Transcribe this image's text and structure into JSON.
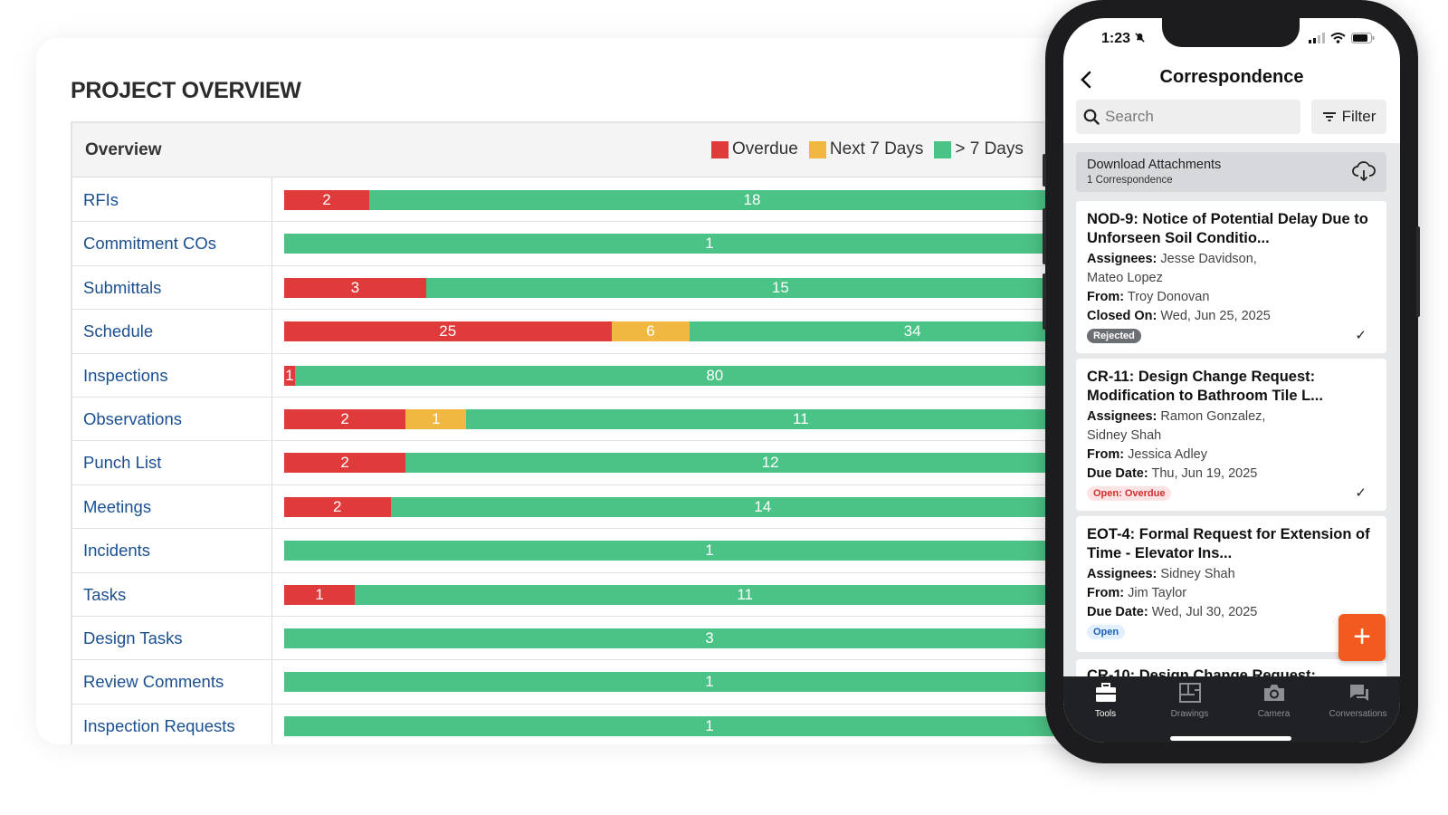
{
  "panel": {
    "title": "PROJECT OVERVIEW",
    "column_header": "Overview",
    "legend": [
      {
        "label": "Overdue",
        "color": "#e03b3b"
      },
      {
        "label": "Next 7 Days",
        "color": "#f0b840"
      },
      {
        "label": "> 7 Days",
        "color": "#4cc386"
      }
    ],
    "rows": [
      {
        "label": "RFIs",
        "overdue": 2,
        "next7": 0,
        "later": 18
      },
      {
        "label": "Commitment COs",
        "overdue": 0,
        "next7": 0,
        "later": 1
      },
      {
        "label": "Submittals",
        "overdue": 3,
        "next7": 0,
        "later": 15
      },
      {
        "label": "Schedule",
        "overdue": 25,
        "next7": 6,
        "later": 34
      },
      {
        "label": "Inspections",
        "overdue": 1,
        "next7": 0,
        "later": 80
      },
      {
        "label": "Observations",
        "overdue": 2,
        "next7": 1,
        "later": 11
      },
      {
        "label": "Punch List",
        "overdue": 2,
        "next7": 0,
        "later": 12
      },
      {
        "label": "Meetings",
        "overdue": 2,
        "next7": 0,
        "later": 14
      },
      {
        "label": "Incidents",
        "overdue": 0,
        "next7": 0,
        "later": 1
      },
      {
        "label": "Tasks",
        "overdue": 1,
        "next7": 0,
        "later": 11
      },
      {
        "label": "Design Tasks",
        "overdue": 0,
        "next7": 0,
        "later": 3
      },
      {
        "label": "Review Comments",
        "overdue": 0,
        "next7": 0,
        "later": 1
      },
      {
        "label": "Inspection Requests",
        "overdue": 0,
        "next7": 0,
        "later": 1
      }
    ]
  },
  "phone": {
    "status_time": "1:23",
    "title": "Correspondence",
    "search_placeholder": "Search",
    "filter_label": "Filter",
    "download": {
      "title": "Download Attachments",
      "subtitle": "1 Correspondence"
    },
    "cards": [
      {
        "title": "NOD-9: Notice of Potential Delay Due to Unforseen Soil Conditio...",
        "assignees_label": "Assignees:",
        "assignees_1": "Jesse Davidson,",
        "assignees_2": "Mateo Lopez",
        "from_label": "From:",
        "from": "Troy Donovan",
        "date_label": "Closed On:",
        "date": "Wed, Jun 25, 2025",
        "status": "Rejected",
        "status_bg": "#6b6e72",
        "status_color": "#ffffff",
        "checked": true
      },
      {
        "title": "CR-11: Design Change Request: Modification to Bathroom Tile L...",
        "assignees_label": "Assignees:",
        "assignees_1": "Ramon Gonzalez,",
        "assignees_2": "Sidney Shah",
        "from_label": "From:",
        "from": "Jessica Adley",
        "date_label": "Due Date:",
        "date": "Thu, Jun 19, 2025",
        "status": "Open: Overdue",
        "status_bg": "#fde3e3",
        "status_color": "#d32f2f",
        "checked": true
      },
      {
        "title": "EOT-4: Formal Request for Extension of Time - Elevator Ins...",
        "assignees_label": "Assignees:",
        "assignees_1": "Sidney Shah",
        "from_label": "From:",
        "from": "Jim Taylor",
        "date_label": "Due Date:",
        "date": "Wed, Jul 30, 2025",
        "status": "Open",
        "status_bg": "#e2efff",
        "status_color": "#1d5fb8",
        "checked": false
      }
    ],
    "peek_title": "CR-10: Design Change Request:",
    "fab_label": "+",
    "tabs": [
      {
        "label": "Tools",
        "icon": "toolbox-icon",
        "active": true
      },
      {
        "label": "Drawings",
        "icon": "drawings-icon",
        "active": false
      },
      {
        "label": "Camera",
        "icon": "camera-icon",
        "active": false
      },
      {
        "label": "Conversations",
        "icon": "chat-icon",
        "active": false
      }
    ]
  }
}
